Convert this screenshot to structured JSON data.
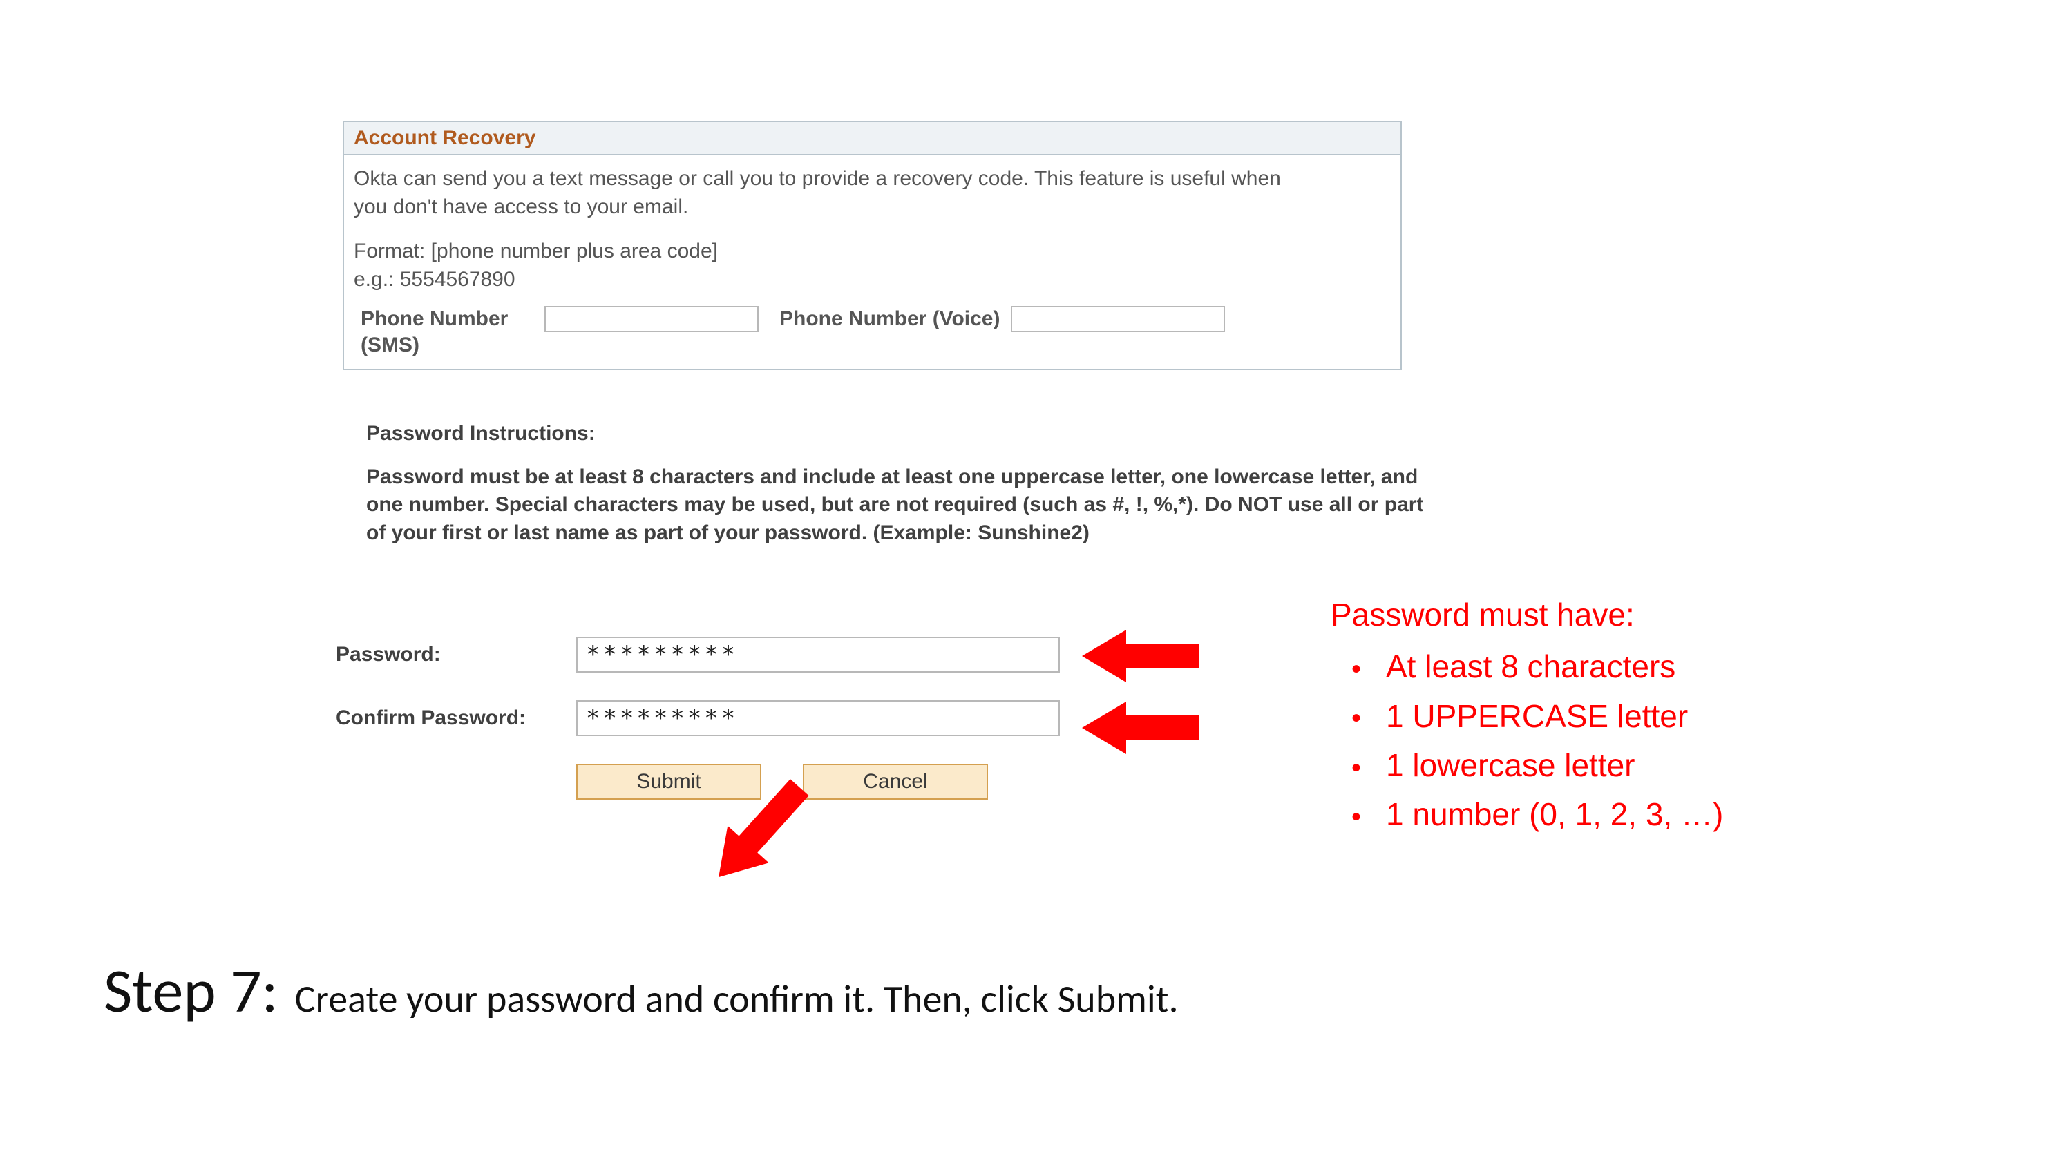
{
  "panel": {
    "title": "Account Recovery",
    "desc1": "Okta can send you a text message or call you to provide a recovery code. This feature is useful when you don't have access to your email.",
    "desc2_line1": "Format: [phone number plus area code]",
    "desc2_line2": "e.g.: 5554567890",
    "sms_label": "Phone Number (SMS)",
    "voice_label": "Phone Number (Voice)",
    "sms_value": "",
    "voice_value": ""
  },
  "instructions": {
    "title": "Password Instructions:",
    "body": "Password must be at least 8 characters and include at least one uppercase letter, one lowercase letter, and one number. Special characters may be used, but are not required (such as #, !, %,*). Do NOT use all or part of your first or last name as part of your password. (Example: Sunshine2)"
  },
  "password": {
    "label": "Password:",
    "confirm_label": "Confirm Password:",
    "value": "*********",
    "confirm_value": "*********",
    "submit_label": "Submit",
    "cancel_label": "Cancel"
  },
  "requirements": {
    "title": "Password must have:",
    "items": [
      "At least 8 characters",
      "1 UPPERCASE letter",
      "1 lowercase letter",
      "1 number (0, 1, 2, 3, …)"
    ]
  },
  "step": {
    "label": "Step 7:",
    "text_before": "Create your password and confirm it. Then, click ",
    "text_submit": "Submit",
    "text_after": "."
  }
}
